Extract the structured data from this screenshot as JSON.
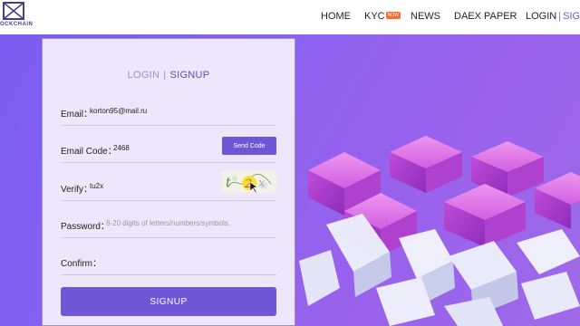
{
  "brand": {
    "logo_text": "OCKCHAIN",
    "accent": "#6d57d6",
    "hero_color": "#8a63f0"
  },
  "nav": {
    "home": "HOME",
    "kyc": "KYC",
    "kyc_badge": "NOW",
    "news": "NEWS",
    "daex_paper": "DAEX PAPER",
    "login": "LOGIN",
    "separator": "|",
    "signup": "SIGNUP"
  },
  "form": {
    "tab_login": "LOGIN",
    "tab_separator": "|",
    "tab_signup": "SIGNUP",
    "email_label": "Email：",
    "email_value": "korton95@mail.ru",
    "email_code_label": "Email Code：",
    "email_code_value": "2468",
    "send_code_label": "Send Code",
    "verify_label": "Verify：",
    "verify_value": "tu2x",
    "captcha_icon": "captcha-image",
    "password_label": "Password：",
    "password_placeholder": "8-20 digits of letters/numbers/symbols.",
    "confirm_label": "Confirm：",
    "confirm_value": "",
    "submit_label": "SIGNUP"
  }
}
